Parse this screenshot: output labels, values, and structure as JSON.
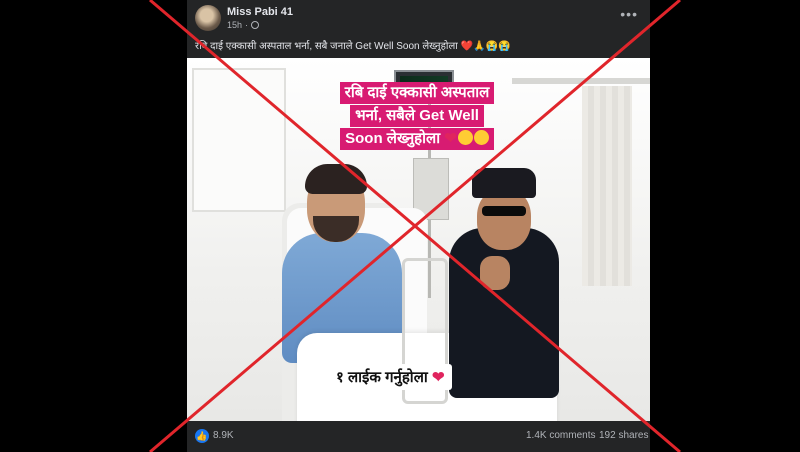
{
  "post": {
    "author": "Miss Pabi 41",
    "time": "15h",
    "time_separator": "·",
    "caption": "रबि दाई एक्कासी अस्पताल भर्ना, सबै जनाले Get Well Soon लेख्नुहोला ❤️🙏😭😭"
  },
  "image_overlay": {
    "title_line1": "रबि दाई एक्कासी अस्पताल",
    "title_line2": "भर्ना, सबैले Get Well",
    "title_line3": "Soon लेख्नुहोला",
    "title_heart": "❤",
    "like_text": "१ लाईक गर्नुहोला",
    "like_heart": "❤"
  },
  "footer": {
    "reactions": "8.9K",
    "comments": "1.4K comments",
    "shares": "192 shares"
  },
  "icons": {
    "more": "more-options-icon",
    "globe": "globe-icon",
    "like": "like-icon"
  },
  "colors": {
    "card_bg": "#242526",
    "overlay_pink": "#d81b72",
    "cross_red": "#e0252b",
    "like_blue": "#1877f2"
  }
}
